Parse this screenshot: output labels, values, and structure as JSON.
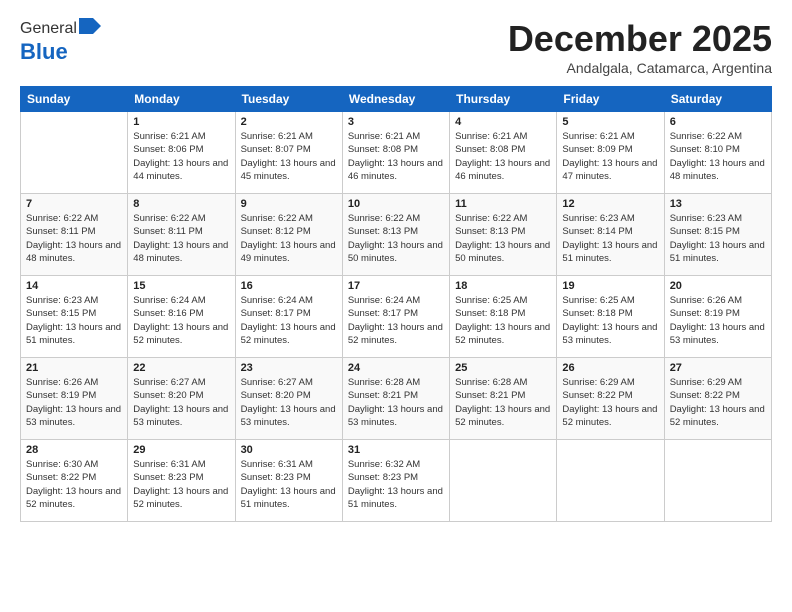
{
  "header": {
    "logo_general": "General",
    "logo_blue": "Blue",
    "month_title": "December 2025",
    "subtitle": "Andalgala, Catamarca, Argentina"
  },
  "days_of_week": [
    "Sunday",
    "Monday",
    "Tuesday",
    "Wednesday",
    "Thursday",
    "Friday",
    "Saturday"
  ],
  "weeks": [
    [
      {
        "day": "",
        "sunrise": "",
        "sunset": "",
        "daylight": ""
      },
      {
        "day": "1",
        "sunrise": "Sunrise: 6:21 AM",
        "sunset": "Sunset: 8:06 PM",
        "daylight": "Daylight: 13 hours and 44 minutes."
      },
      {
        "day": "2",
        "sunrise": "Sunrise: 6:21 AM",
        "sunset": "Sunset: 8:07 PM",
        "daylight": "Daylight: 13 hours and 45 minutes."
      },
      {
        "day": "3",
        "sunrise": "Sunrise: 6:21 AM",
        "sunset": "Sunset: 8:08 PM",
        "daylight": "Daylight: 13 hours and 46 minutes."
      },
      {
        "day": "4",
        "sunrise": "Sunrise: 6:21 AM",
        "sunset": "Sunset: 8:08 PM",
        "daylight": "Daylight: 13 hours and 46 minutes."
      },
      {
        "day": "5",
        "sunrise": "Sunrise: 6:21 AM",
        "sunset": "Sunset: 8:09 PM",
        "daylight": "Daylight: 13 hours and 47 minutes."
      },
      {
        "day": "6",
        "sunrise": "Sunrise: 6:22 AM",
        "sunset": "Sunset: 8:10 PM",
        "daylight": "Daylight: 13 hours and 48 minutes."
      }
    ],
    [
      {
        "day": "7",
        "sunrise": "Sunrise: 6:22 AM",
        "sunset": "Sunset: 8:11 PM",
        "daylight": "Daylight: 13 hours and 48 minutes."
      },
      {
        "day": "8",
        "sunrise": "Sunrise: 6:22 AM",
        "sunset": "Sunset: 8:11 PM",
        "daylight": "Daylight: 13 hours and 48 minutes."
      },
      {
        "day": "9",
        "sunrise": "Sunrise: 6:22 AM",
        "sunset": "Sunset: 8:12 PM",
        "daylight": "Daylight: 13 hours and 49 minutes."
      },
      {
        "day": "10",
        "sunrise": "Sunrise: 6:22 AM",
        "sunset": "Sunset: 8:13 PM",
        "daylight": "Daylight: 13 hours and 50 minutes."
      },
      {
        "day": "11",
        "sunrise": "Sunrise: 6:22 AM",
        "sunset": "Sunset: 8:13 PM",
        "daylight": "Daylight: 13 hours and 50 minutes."
      },
      {
        "day": "12",
        "sunrise": "Sunrise: 6:23 AM",
        "sunset": "Sunset: 8:14 PM",
        "daylight": "Daylight: 13 hours and 51 minutes."
      },
      {
        "day": "13",
        "sunrise": "Sunrise: 6:23 AM",
        "sunset": "Sunset: 8:15 PM",
        "daylight": "Daylight: 13 hours and 51 minutes."
      }
    ],
    [
      {
        "day": "14",
        "sunrise": "Sunrise: 6:23 AM",
        "sunset": "Sunset: 8:15 PM",
        "daylight": "Daylight: 13 hours and 51 minutes."
      },
      {
        "day": "15",
        "sunrise": "Sunrise: 6:24 AM",
        "sunset": "Sunset: 8:16 PM",
        "daylight": "Daylight: 13 hours and 52 minutes."
      },
      {
        "day": "16",
        "sunrise": "Sunrise: 6:24 AM",
        "sunset": "Sunset: 8:17 PM",
        "daylight": "Daylight: 13 hours and 52 minutes."
      },
      {
        "day": "17",
        "sunrise": "Sunrise: 6:24 AM",
        "sunset": "Sunset: 8:17 PM",
        "daylight": "Daylight: 13 hours and 52 minutes."
      },
      {
        "day": "18",
        "sunrise": "Sunrise: 6:25 AM",
        "sunset": "Sunset: 8:18 PM",
        "daylight": "Daylight: 13 hours and 52 minutes."
      },
      {
        "day": "19",
        "sunrise": "Sunrise: 6:25 AM",
        "sunset": "Sunset: 8:18 PM",
        "daylight": "Daylight: 13 hours and 53 minutes."
      },
      {
        "day": "20",
        "sunrise": "Sunrise: 6:26 AM",
        "sunset": "Sunset: 8:19 PM",
        "daylight": "Daylight: 13 hours and 53 minutes."
      }
    ],
    [
      {
        "day": "21",
        "sunrise": "Sunrise: 6:26 AM",
        "sunset": "Sunset: 8:19 PM",
        "daylight": "Daylight: 13 hours and 53 minutes."
      },
      {
        "day": "22",
        "sunrise": "Sunrise: 6:27 AM",
        "sunset": "Sunset: 8:20 PM",
        "daylight": "Daylight: 13 hours and 53 minutes."
      },
      {
        "day": "23",
        "sunrise": "Sunrise: 6:27 AM",
        "sunset": "Sunset: 8:20 PM",
        "daylight": "Daylight: 13 hours and 53 minutes."
      },
      {
        "day": "24",
        "sunrise": "Sunrise: 6:28 AM",
        "sunset": "Sunset: 8:21 PM",
        "daylight": "Daylight: 13 hours and 53 minutes."
      },
      {
        "day": "25",
        "sunrise": "Sunrise: 6:28 AM",
        "sunset": "Sunset: 8:21 PM",
        "daylight": "Daylight: 13 hours and 52 minutes."
      },
      {
        "day": "26",
        "sunrise": "Sunrise: 6:29 AM",
        "sunset": "Sunset: 8:22 PM",
        "daylight": "Daylight: 13 hours and 52 minutes."
      },
      {
        "day": "27",
        "sunrise": "Sunrise: 6:29 AM",
        "sunset": "Sunset: 8:22 PM",
        "daylight": "Daylight: 13 hours and 52 minutes."
      }
    ],
    [
      {
        "day": "28",
        "sunrise": "Sunrise: 6:30 AM",
        "sunset": "Sunset: 8:22 PM",
        "daylight": "Daylight: 13 hours and 52 minutes."
      },
      {
        "day": "29",
        "sunrise": "Sunrise: 6:31 AM",
        "sunset": "Sunset: 8:23 PM",
        "daylight": "Daylight: 13 hours and 52 minutes."
      },
      {
        "day": "30",
        "sunrise": "Sunrise: 6:31 AM",
        "sunset": "Sunset: 8:23 PM",
        "daylight": "Daylight: 13 hours and 51 minutes."
      },
      {
        "day": "31",
        "sunrise": "Sunrise: 6:32 AM",
        "sunset": "Sunset: 8:23 PM",
        "daylight": "Daylight: 13 hours and 51 minutes."
      },
      {
        "day": "",
        "sunrise": "",
        "sunset": "",
        "daylight": ""
      },
      {
        "day": "",
        "sunrise": "",
        "sunset": "",
        "daylight": ""
      },
      {
        "day": "",
        "sunrise": "",
        "sunset": "",
        "daylight": ""
      }
    ]
  ]
}
